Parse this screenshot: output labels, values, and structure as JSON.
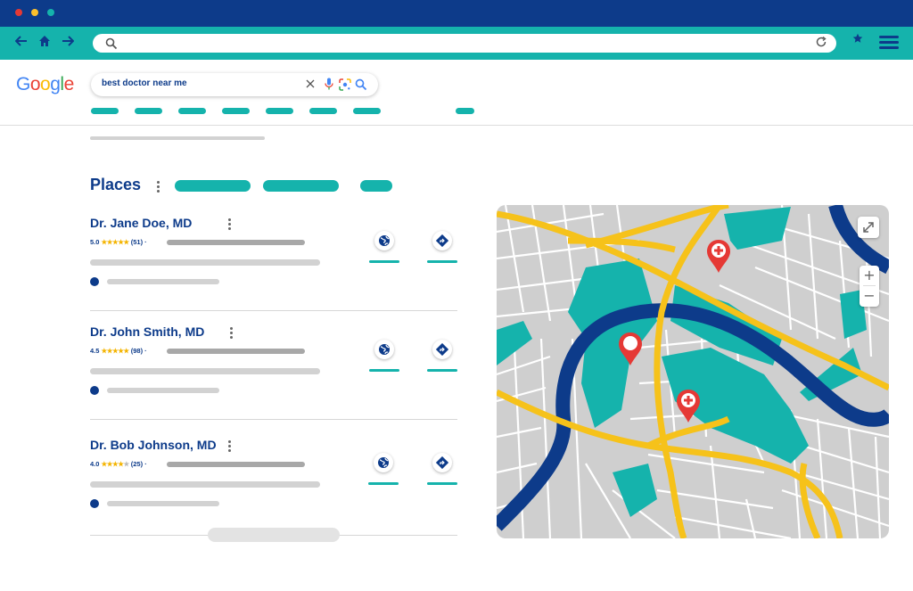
{
  "browser": {
    "controls": [
      {
        "name": "close-dot",
        "color": "#e53935"
      },
      {
        "name": "minimize-dot",
        "color": "#fbc02d"
      },
      {
        "name": "maximize-dot",
        "color": "#15b3ac"
      }
    ],
    "nav_icons": [
      "back-arrow-icon",
      "home-icon",
      "forward-arrow-icon"
    ],
    "address_value": "",
    "colors": {
      "titlebar": "#0d3b8a",
      "toolbar": "#15b3ac"
    }
  },
  "google": {
    "logo_letters": [
      {
        "ch": "G",
        "color": "#4285f4"
      },
      {
        "ch": "o",
        "color": "#ea4335"
      },
      {
        "ch": "o",
        "color": "#fbbc05"
      },
      {
        "ch": "g",
        "color": "#4285f4"
      },
      {
        "ch": "l",
        "color": "#34a853"
      },
      {
        "ch": "e",
        "color": "#ea4335"
      }
    ],
    "query": "best doctor near me"
  },
  "places": {
    "title": "Places",
    "results": [
      {
        "name": "Dr. Jane Doe, MD",
        "rating": "5.0",
        "stars_filled": 5,
        "reviews": "(51)"
      },
      {
        "name": "Dr. John Smith, MD",
        "rating": "4.5",
        "stars_filled": 5,
        "reviews": "(98)"
      },
      {
        "name": "Dr. Bob Johnson, MD",
        "rating": "4.0",
        "stars_filled": 4,
        "reviews": "(25)"
      }
    ]
  },
  "map": {
    "pins": [
      "hospital-pin",
      "hospital-pin",
      "location-pin"
    ],
    "controls": {
      "expand": "expand-icon",
      "zoom_in": "+",
      "zoom_out": "−"
    },
    "colors": {
      "land": "#cfcfcf",
      "roads": "#ffffff",
      "highways": "#f6c21a",
      "river": "#0d3b8a",
      "parks": "#15b3ac",
      "pins": "#e53935"
    }
  }
}
